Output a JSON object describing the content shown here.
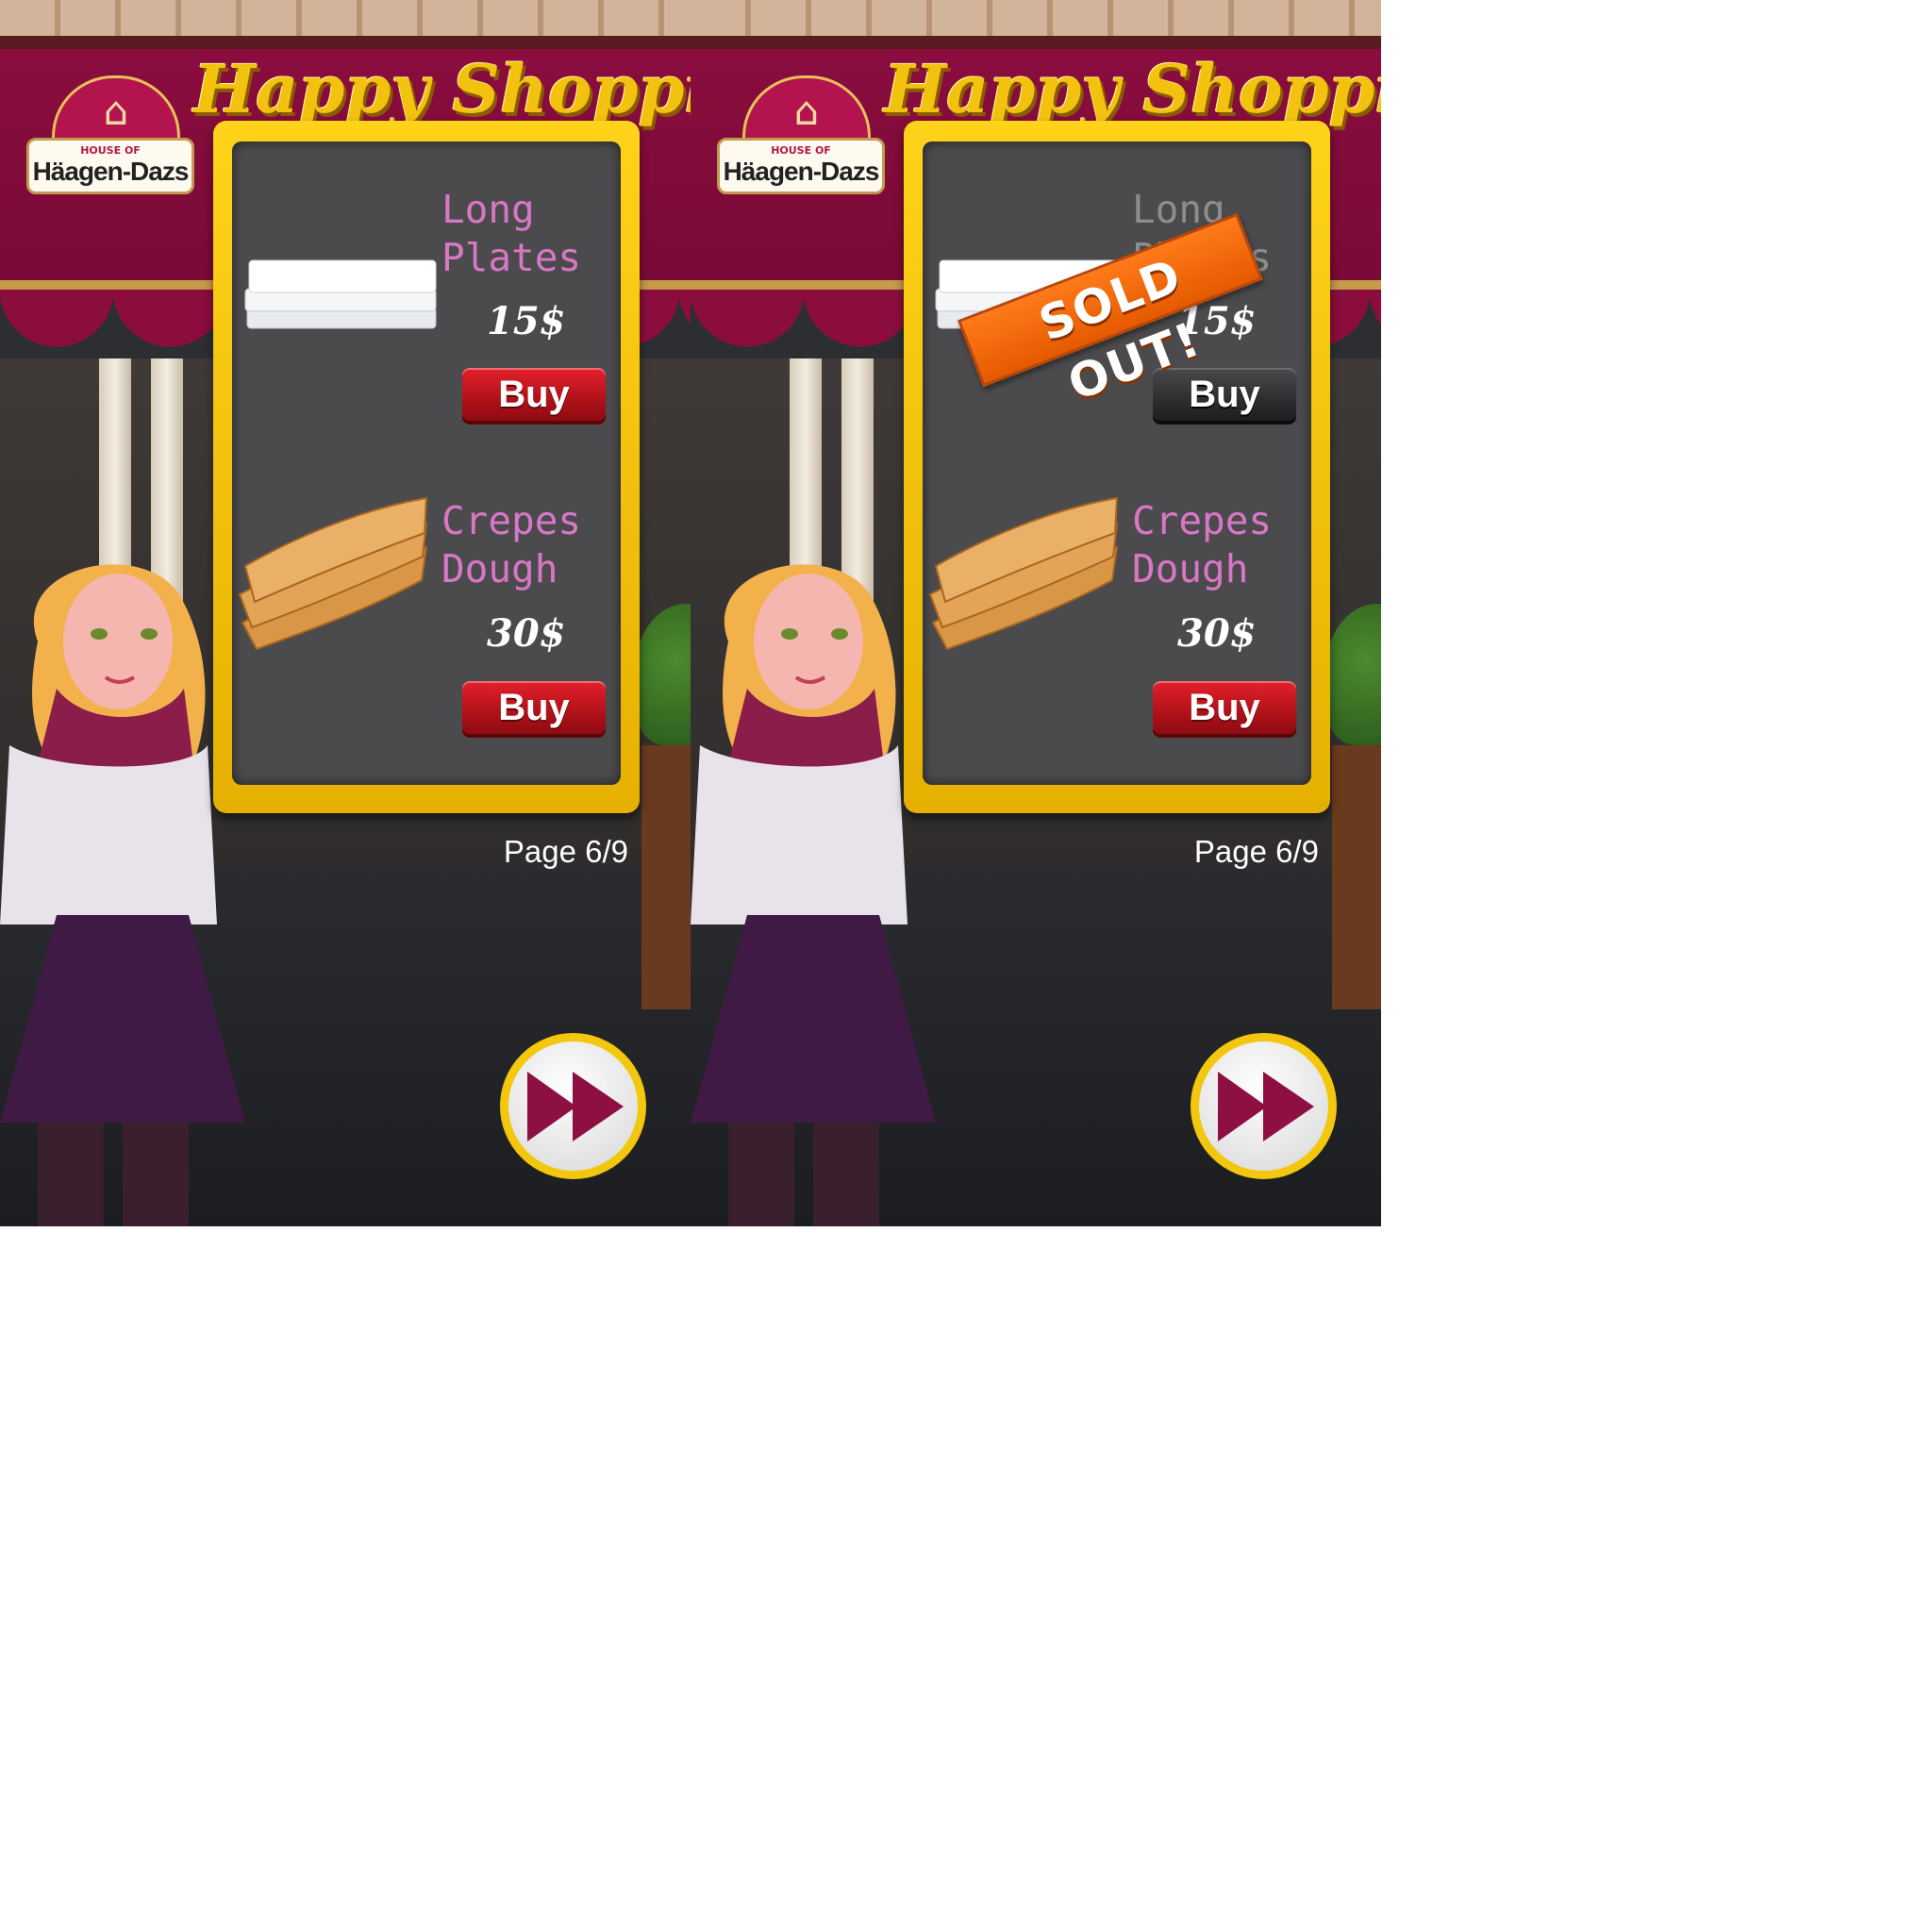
{
  "screens": [
    {
      "id": "left",
      "logo": {
        "small": "HOUSE OF",
        "brand": "Häagen-Dazs"
      },
      "title": "Happy Shopping",
      "items": [
        {
          "name": "Long\nPlates",
          "price": "15$",
          "buy_label": "Buy",
          "sold_out": false
        },
        {
          "name": "Crepes\nDough",
          "price": "30$",
          "buy_label": "Buy",
          "sold_out": false
        }
      ],
      "page_indicator": "Page 6/9",
      "next_icon": "fast-forward-icon"
    },
    {
      "id": "right",
      "logo": {
        "small": "HOUSE OF",
        "brand": "Häagen-Dazs"
      },
      "title": "Happy Shopping",
      "items": [
        {
          "name": "Long\nPlates",
          "price": "15$",
          "buy_label": "Buy",
          "sold_out": true,
          "sold_out_label": "SOLD OUT!"
        },
        {
          "name": "Crepes\nDough",
          "price": "30$",
          "buy_label": "Buy",
          "sold_out": false
        }
      ],
      "page_indicator": "Page 6/9",
      "next_icon": "fast-forward-icon"
    }
  ],
  "colors": {
    "accent_gold": "#f2c20f",
    "awning": "#8a0d3e",
    "item_name": "#d977c6",
    "buy_red": "#c8161f",
    "sold_out_orange": "#f06a0a",
    "board": "#4b4b4d"
  }
}
